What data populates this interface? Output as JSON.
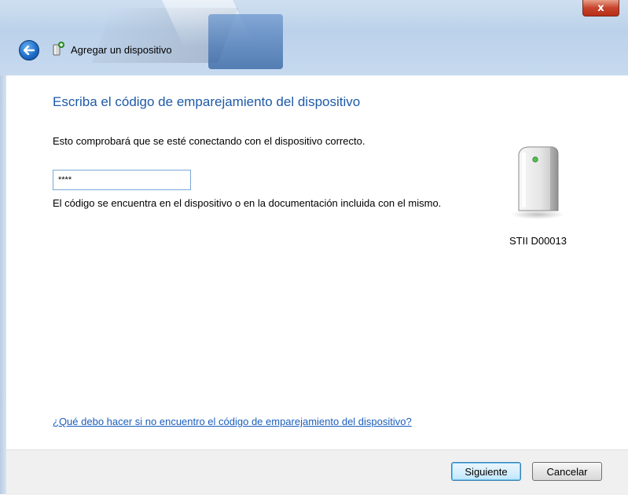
{
  "window": {
    "title": "Agregar un dispositivo",
    "close_label": "x"
  },
  "main": {
    "heading": "Escriba el código de emparejamiento del dispositivo",
    "subtext": "Esto comprobará que se esté conectando con el dispositivo correcto.",
    "code_value": "****",
    "hint": "El código se encuentra en el dispositivo o en la documentación incluida con el mismo.",
    "device_name": "STII D00013",
    "help_link": "¿Qué debo hacer si no encuentro el código de emparejamiento del dispositivo?"
  },
  "footer": {
    "next_label": "Siguiente",
    "cancel_label": "Cancelar"
  },
  "colors": {
    "heading": "#1e5aa8",
    "link": "#1b5ebd",
    "close_button": "#c7442d"
  },
  "icons": {
    "back": "back-arrow-icon",
    "title": "device-add-icon",
    "device": "device-tower-icon"
  }
}
